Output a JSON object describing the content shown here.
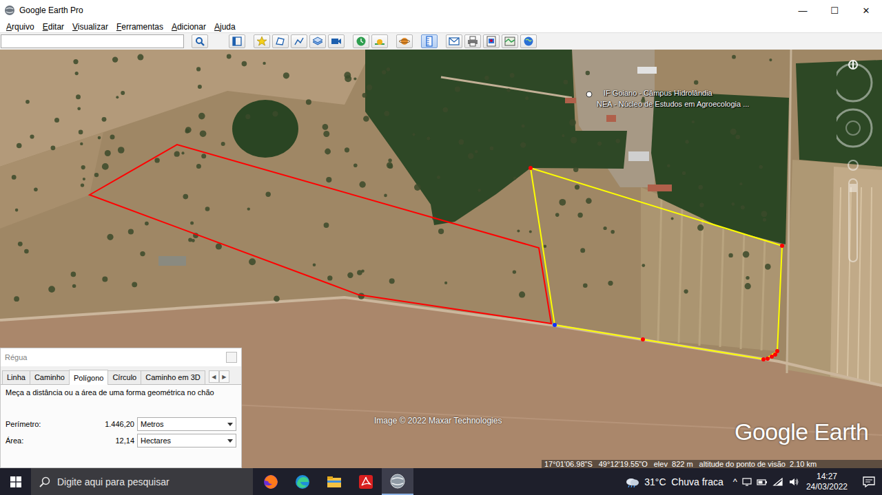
{
  "window": {
    "title": "Google Earth Pro",
    "controls": [
      "—",
      "☐",
      "✕"
    ]
  },
  "menu": [
    "Arquivo",
    "Editar",
    "Visualizar",
    "Ferramentas",
    "Adicionar",
    "Ajuda"
  ],
  "map": {
    "labels": [
      "IF Goiano - Câmpus Hidrolândia",
      "NEA - Núcleo de Estudos em Agroecologia ..."
    ],
    "attribution": "Image © 2022 Maxar Technologies",
    "logo": "Google Earth",
    "status": [
      "17°01'06.98\"S",
      "49°12'19.55\"O",
      "elev  822 m",
      "altitude do ponto de visão  2.10 km"
    ],
    "shapes": [
      {
        "color": "#ff0000"
      },
      {
        "color": "#ffff00"
      }
    ]
  },
  "ruler": {
    "title": "Régua",
    "tabs": [
      {
        "label": "Linha",
        "selected": false
      },
      {
        "label": "Caminho",
        "selected": false
      },
      {
        "label": "Polígono",
        "selected": true
      },
      {
        "label": "Círculo",
        "selected": false
      },
      {
        "label": "Caminho em 3D",
        "selected": false
      }
    ],
    "tab_arrows": [
      "◀",
      "▶"
    ],
    "description": "Meça a distância ou a área de uma forma geométrica no chão",
    "rows": [
      {
        "label": "Perímetro:",
        "value": "1.446,20",
        "unit": "Metros"
      },
      {
        "label": "Área:",
        "value": "12,14",
        "unit": "Hectares"
      }
    ]
  },
  "taskbar": {
    "search_placeholder": "Digite aqui para pesquisar",
    "apps": [
      {
        "kind": "firefox",
        "selected": false
      },
      {
        "kind": "edge",
        "selected": false
      },
      {
        "kind": "explorer",
        "selected": false
      },
      {
        "kind": "acrobat",
        "selected": false
      },
      {
        "kind": "earth",
        "selected": true
      }
    ],
    "weather": "31°C  Chuva fraca",
    "tray_caret": "^",
    "time": "14:27",
    "date": "24/03/2022"
  }
}
